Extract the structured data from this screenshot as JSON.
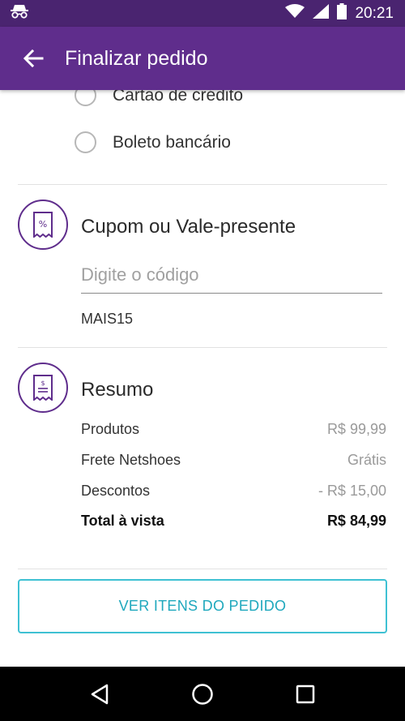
{
  "status_bar": {
    "time": "20:21",
    "icons": [
      "incognito-icon",
      "wifi-icon",
      "signal-icon",
      "battery-icon"
    ]
  },
  "app_bar": {
    "title": "Finalizar pedido",
    "back_icon": "arrow-left-icon"
  },
  "payment": {
    "options": [
      {
        "label": "Cartão de crédito",
        "selected": false
      },
      {
        "label": "Boleto bancário",
        "selected": false
      }
    ]
  },
  "coupon": {
    "title": "Cupom ou Vale-presente",
    "icon": "coupon-icon",
    "input_placeholder": "Digite o código",
    "input_value": "",
    "applied_code": "MAIS15"
  },
  "summary": {
    "title": "Resumo",
    "icon": "receipt-icon",
    "rows": [
      {
        "label": "Produtos",
        "value": "R$ 99,99"
      },
      {
        "label": "Frete Netshoes",
        "value": "Grátis"
      },
      {
        "label": "Descontos",
        "value": "- R$ 15,00"
      }
    ],
    "total": {
      "label": "Total à vista",
      "value": "R$ 84,99"
    }
  },
  "actions": {
    "view_items_label": "VER ITENS DO PEDIDO"
  },
  "nav_bar": {
    "buttons": [
      "back-triangle-icon",
      "home-circle-icon",
      "recents-square-icon"
    ]
  },
  "colors": {
    "status_bar": "#4a2470",
    "app_bar": "#5f2d8c",
    "accent_teal": "#3ec1d3",
    "divider": "#e2e2e2"
  }
}
